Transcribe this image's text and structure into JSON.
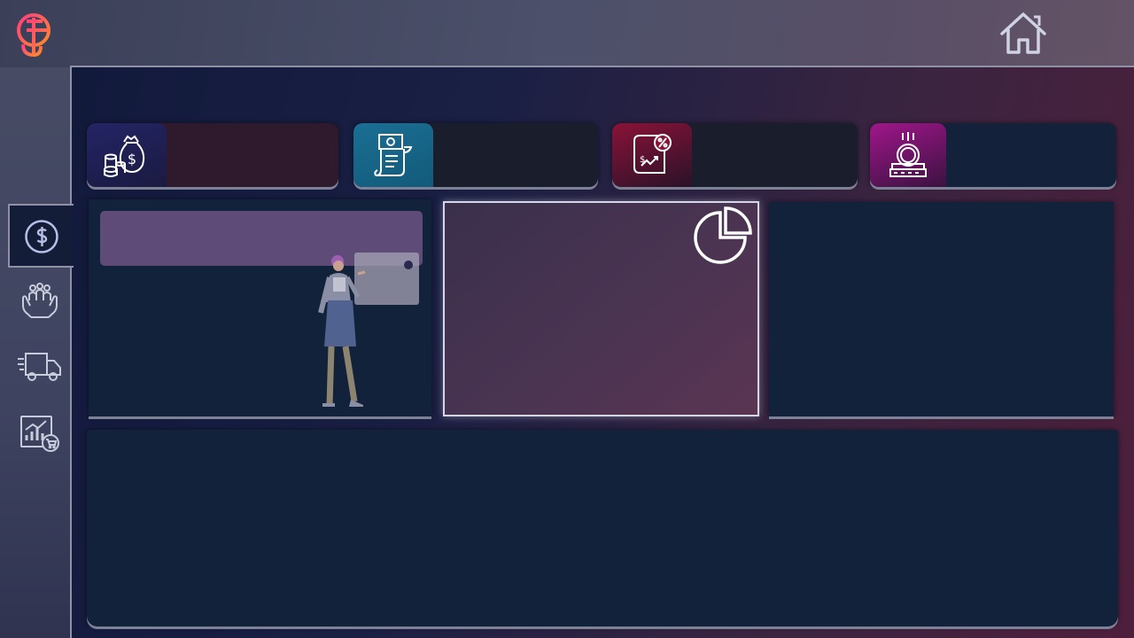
{
  "app": {
    "logo_icon": "brand-logo-icon",
    "home_icon": "home-icon"
  },
  "sidebar": {
    "items": [
      {
        "icon": "dollar-circle-icon",
        "active": true
      },
      {
        "icon": "customers-hands-icon",
        "active": false
      },
      {
        "icon": "delivery-truck-icon",
        "active": false
      },
      {
        "icon": "sales-chart-cart-icon",
        "active": false
      }
    ]
  },
  "kpis": [
    {
      "icon": "money-bag-coins-icon",
      "value": "",
      "accent": "#242466"
    },
    {
      "icon": "invoice-receipt-icon",
      "value": "",
      "accent": "#1a6f94"
    },
    {
      "icon": "percent-document-icon",
      "value": "",
      "accent": "#8a1238"
    },
    {
      "icon": "coin-drop-icon",
      "value": "",
      "accent": "#a0168a"
    }
  ],
  "intro": {
    "banner_text": "",
    "illustration": "woman-presenting-illustration"
  },
  "highlight": {
    "icon": "pie-chart-icon"
  },
  "colors": {
    "panel": "#12223a",
    "banner": "#5e4b78",
    "highlight_border": "#d4d7ea"
  }
}
